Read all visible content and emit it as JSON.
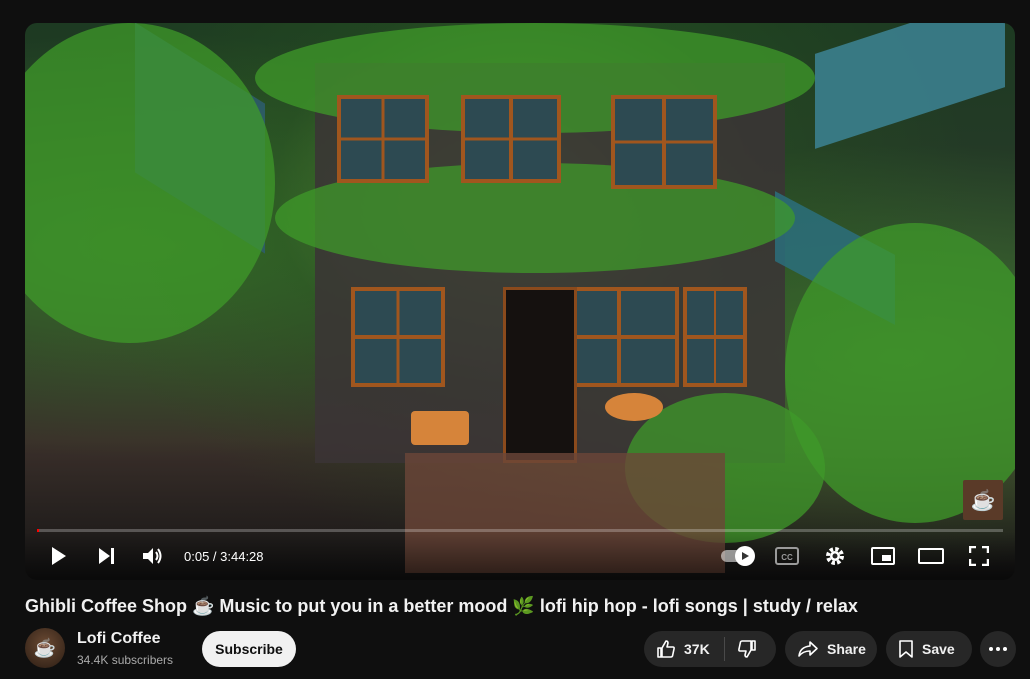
{
  "video": {
    "current_time": "0:05",
    "duration": "3:44:28",
    "time_display": "0:05 / 3:44:28",
    "progress_fraction": 0.0004,
    "progress_color": "#ff0000",
    "autoplay_on": true,
    "thumb_badge_icon": "coffee-cup-icon"
  },
  "title": "Ghibli Coffee Shop ☕ Music to put you in a better mood 🌿 lofi hip hop - lofi songs | study / relax",
  "channel": {
    "name": "Lofi Coffee",
    "subscribers": "34.4K subscribers",
    "avatar_icon": "coffee-cup-icon"
  },
  "actions": {
    "subscribe": "Subscribe",
    "likes": "37K",
    "share": "Share",
    "save": "Save"
  },
  "colors": {
    "background": "#0f0f0f",
    "pill": "#272727",
    "subscribe_bg": "#f1f1f1"
  }
}
